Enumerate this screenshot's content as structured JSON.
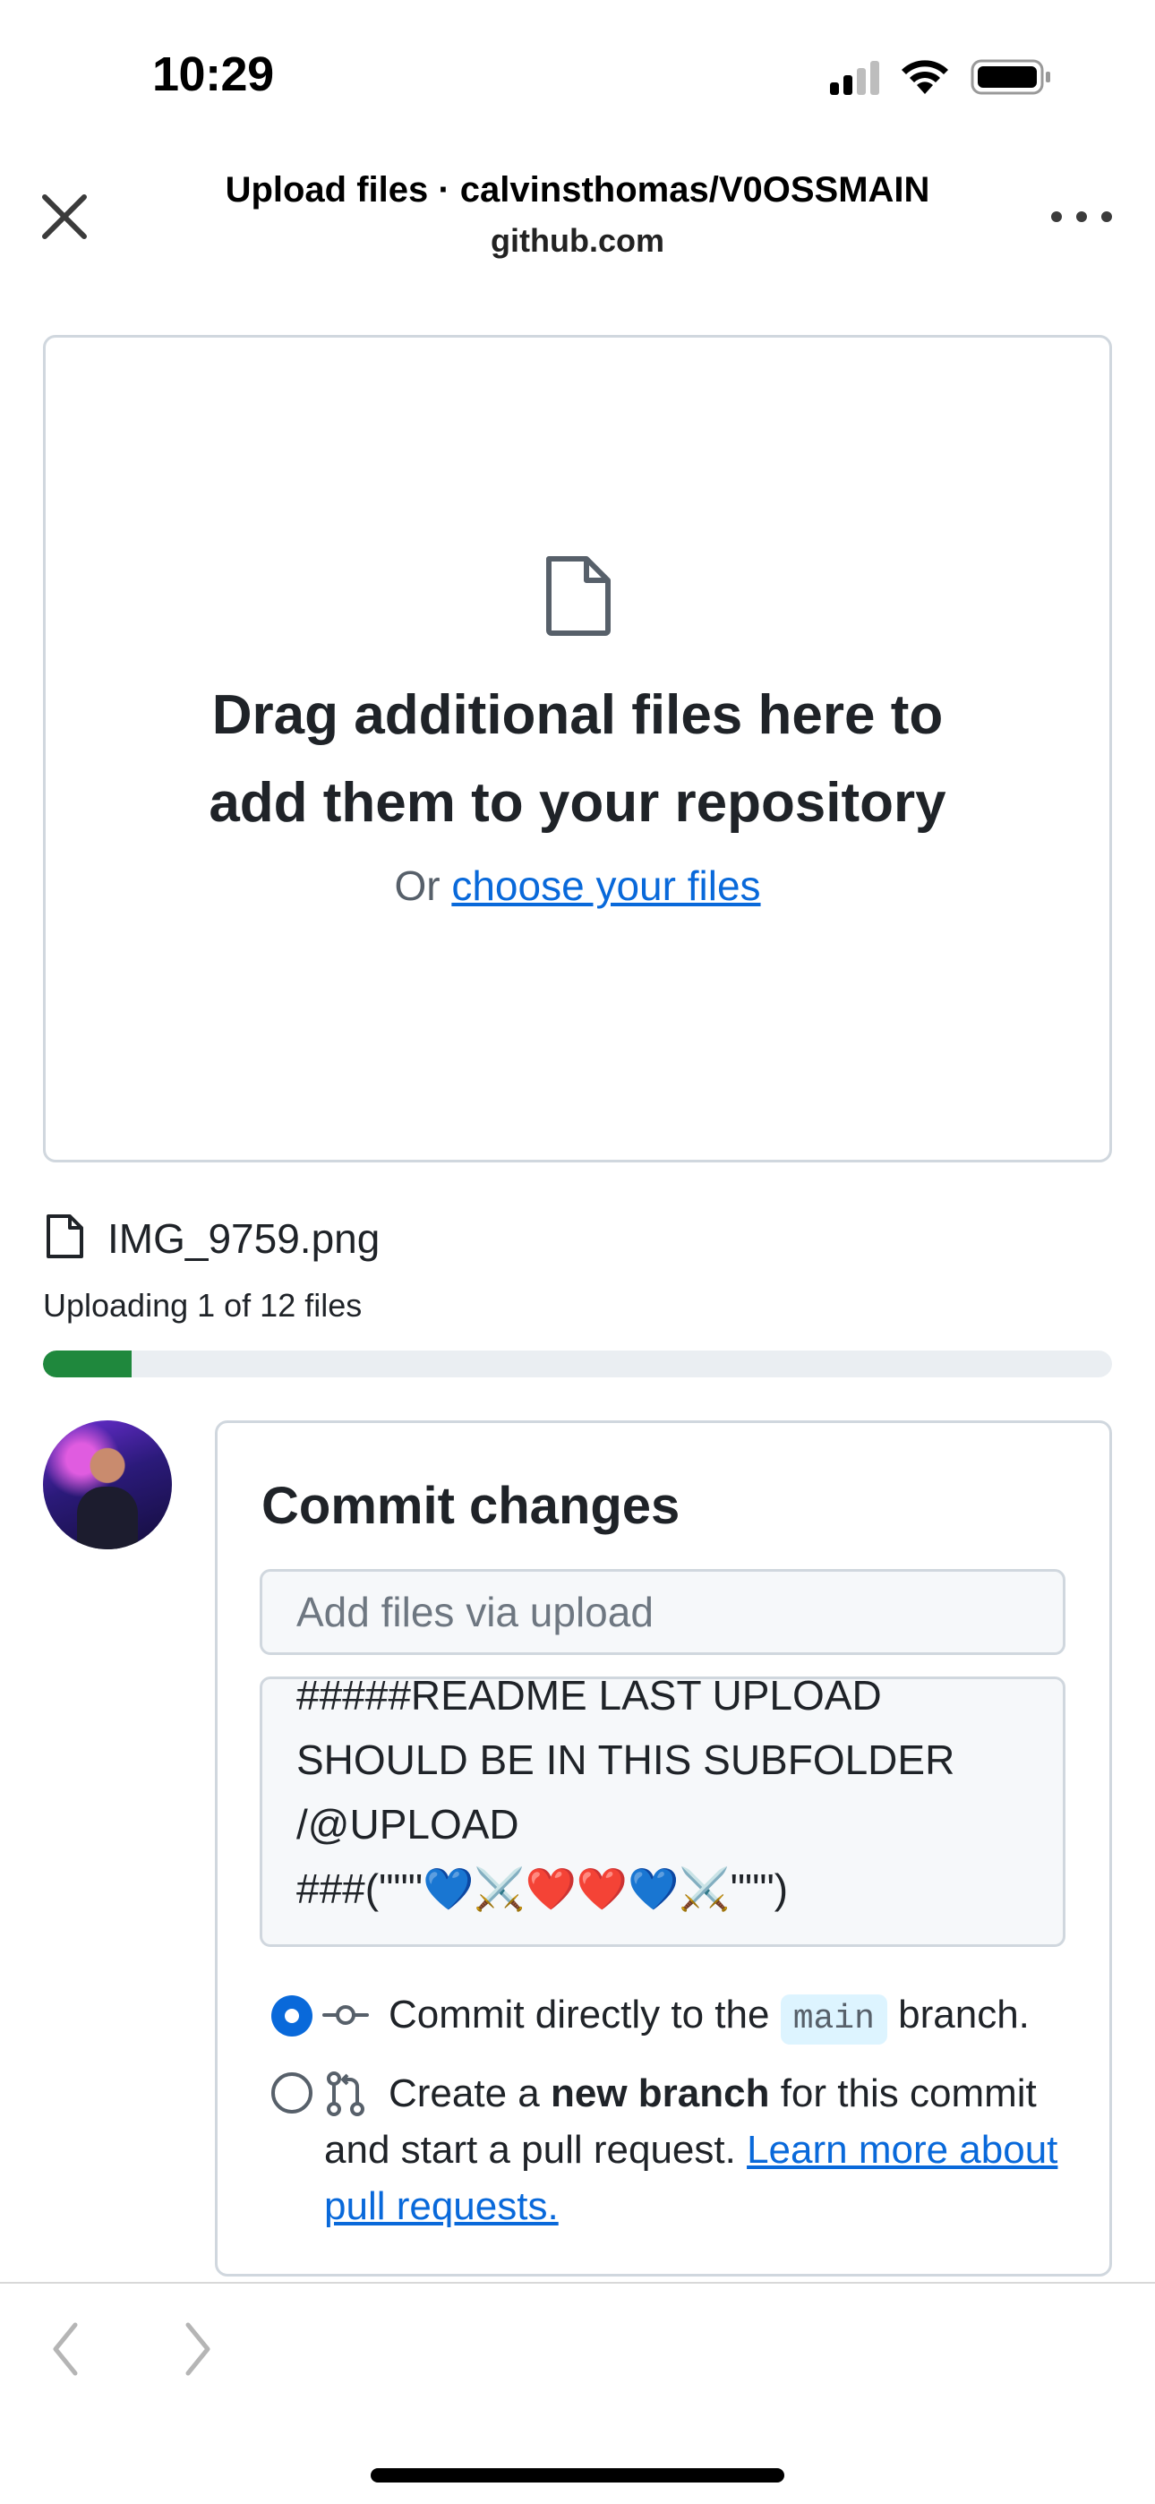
{
  "status_bar": {
    "time": "10:29"
  },
  "header": {
    "title": "Upload files · calvinsthomas/V0OSSMAIN",
    "subtitle": "github.com",
    "close_icon": "close-icon",
    "more_icon": "more-icon"
  },
  "dropzone": {
    "title_line1": "Drag additional files here to",
    "title_line2": "add them to your repository",
    "or_text": "Or ",
    "choose_link": "choose your files"
  },
  "upload": {
    "file_name": "IMG_9759.png",
    "status": "Uploading 1 of 12 files",
    "progress_fraction": 0.0833
  },
  "commit": {
    "title": "Commit changes",
    "summary_placeholder": "Add files via upload",
    "description": "#####README LAST UPLOAD\nSHOULD BE IN THIS SUBFOLDER\n/@UPLOAD\n###(\"\"\"💙⚔️❤️❤️💙⚔️\"\"\")",
    "option_direct_prefix": "Commit directly to the ",
    "option_direct_branch": "main",
    "option_direct_suffix": " branch.",
    "option_branch_prefix": "Create a ",
    "option_branch_bold": "new branch",
    "option_branch_suffix": " for this commit and start a pull request. ",
    "option_branch_link": "Learn more about pull requests."
  },
  "colors": {
    "link": "#0969da",
    "progress": "#1f883d",
    "radio_selected": "#0969da",
    "border": "#d0d7de"
  }
}
